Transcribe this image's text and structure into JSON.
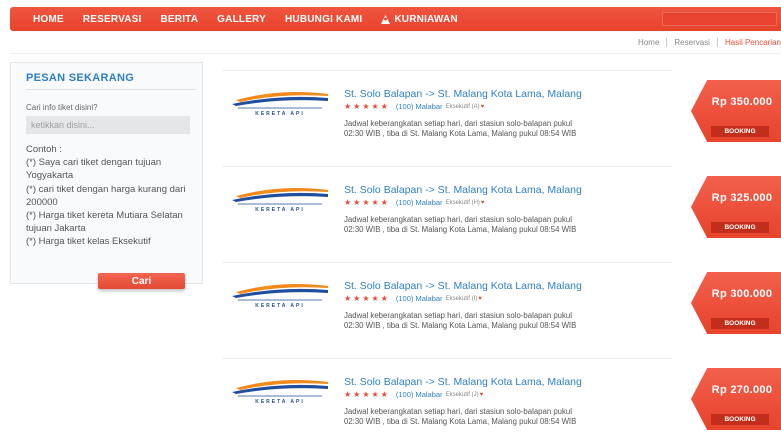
{
  "nav": {
    "items": [
      "HOME",
      "RESERVASI",
      "BERITA",
      "GALLERY",
      "HUBUNGI KAMI"
    ],
    "user": "KURNIAWAN",
    "user_icon": "user-icon"
  },
  "breadcrumb": [
    "Home",
    "Reservasi",
    "Hasil Pencarian"
  ],
  "sidebar": {
    "title": "PESAN SEKARANG",
    "search_label": "Cari info tiket disini?",
    "search_placeholder": "ketikkan disini...",
    "examples_heading": "Contoh :",
    "examples": [
      "(*) Saya cari tiket dengan tujuan Yogyakarta",
      "(*) cari tiket dengan harga kurang dari 200000",
      "(*) Harga tiket kereta Mutiara Selatan tujuan Jakarta",
      "(*) Harga tiket kelas Eksekutif"
    ],
    "button": "Cari"
  },
  "results": [
    {
      "logo_text": "KERETA API",
      "route": "St. Solo Balapan -> St. Malang Kota Lama, Malang",
      "stars": "★★★★★",
      "reviews": "(100)",
      "train": "Malabar",
      "class": "Eksekutif (A)",
      "desc_line1": "Jadwal keberangkatan setiap hari, dari stasiun solo-balapan pukul",
      "desc_line2": "02:30 WIB , tiba di St. Malang Kota Lama, Malang pukul 08:54 WIB",
      "price": "Rp 350.000",
      "booking": "BOOKING"
    },
    {
      "logo_text": "KERETA API",
      "route": "St. Solo Balapan -> St. Malang Kota Lama, Malang",
      "stars": "★★★★★",
      "reviews": "(100)",
      "train": "Malabar",
      "class": "Eksekutif (H)",
      "desc_line1": "Jadwal keberangkatan setiap hari, dari stasiun solo-balapan pukul",
      "desc_line2": "02:30 WIB , tiba di St. Malang Kota Lama, Malang pukul 08:54 WIB",
      "price": "Rp 325.000",
      "booking": "BOOKING"
    },
    {
      "logo_text": "KERETA API",
      "route": "St. Solo Balapan -> St. Malang Kota Lama, Malang",
      "stars": "★★★★★",
      "reviews": "(100)",
      "train": "Malabar",
      "class": "Eksekutif (I)",
      "desc_line1": "Jadwal keberangkatan setiap hari, dari stasiun solo-balapan pukul",
      "desc_line2": "02:30 WIB , tiba di St. Malang Kota Lama, Malang pukul 08:54 WIB",
      "price": "Rp 300.000",
      "booking": "BOOKING"
    },
    {
      "logo_text": "KERETA API",
      "route": "St. Solo Balapan -> St. Malang Kota Lama, Malang",
      "stars": "★★★★★",
      "reviews": "(100)",
      "train": "Malabar",
      "class": "Eksekutif (J)",
      "desc_line1": "Jadwal keberangkatan setiap hari, dari stasiun solo-balapan pukul",
      "desc_line2": "02:30 WIB , tiba di St. Malang Kota Lama, Malang pukul 08:54 WIB",
      "price": "Rp 270.000",
      "booking": "BOOKING"
    }
  ],
  "colors": {
    "accent": "#e8432d",
    "link": "#2f80c4",
    "logo_blue": "#1f4e9c",
    "logo_orange": "#f08a1c"
  }
}
